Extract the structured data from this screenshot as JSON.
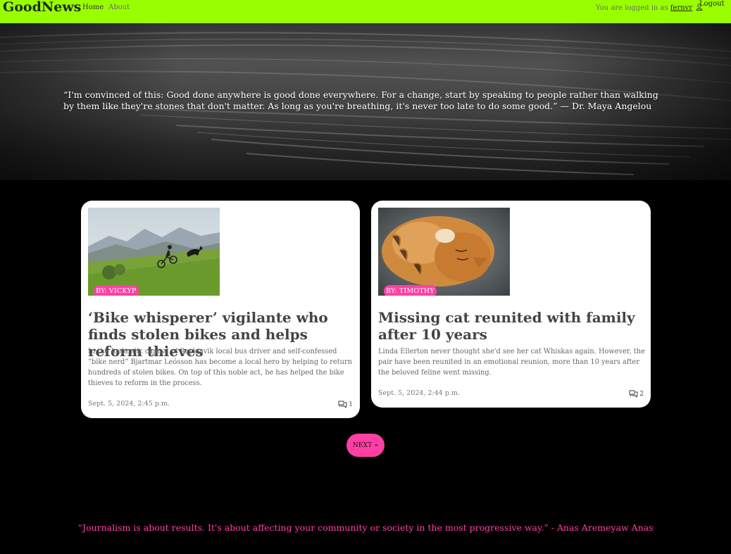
{
  "navbar": {
    "brand": "GoodNews",
    "links": [
      "Home",
      "About"
    ],
    "login_prefix": "You are logged in as",
    "username": "fernvr",
    "logout": "Logout"
  },
  "hero": {
    "quote": "“I'm convinced of this: Good done anywhere is good done everywhere. For a change, start by speaking to people rather than walking by them like they're stones that don't matter. As long as you're breathing, it's never too late to do some good.” — Dr. Maya Angelou"
  },
  "articles": [
    {
      "author": "BY: VICKYP",
      "title": "‘Bike whisperer’ vigilante who finds stolen bikes and helps reform thieves",
      "excerpt": "In the Icelandic capital of Reykjavik local bus driver and self-confessed “bike nerd” Bjartmar Leósson has become a local hero by helping to return hundreds of stolen bikes. On top of this noble act, he has helped the bike thieves to reform in the process.",
      "date": "Sept. 5, 2024, 2:45 p.m.",
      "comments": "1"
    },
    {
      "author": "BY: TIMOTHY",
      "title": "Missing cat reunited with family after 10 years",
      "excerpt": "Linda Ellerton never thought she'd see her cat Whiskas again. However, the pair have been reunited in an emotional reunion, more than 10 years after the beloved feline went missing.",
      "date": "Sept. 5, 2024, 2:44 p.m.",
      "comments": "2"
    }
  ],
  "pagination": {
    "next": "NEXT »"
  },
  "footer": {
    "quote": "“Journalism is about results. It's about affecting your community or society in the most progressive way.” - Anas Aremeyaw Anas"
  },
  "colors": {
    "nav_bg": "#99ff00",
    "accent": "#ff3fa4",
    "page_bg": "#000000"
  }
}
